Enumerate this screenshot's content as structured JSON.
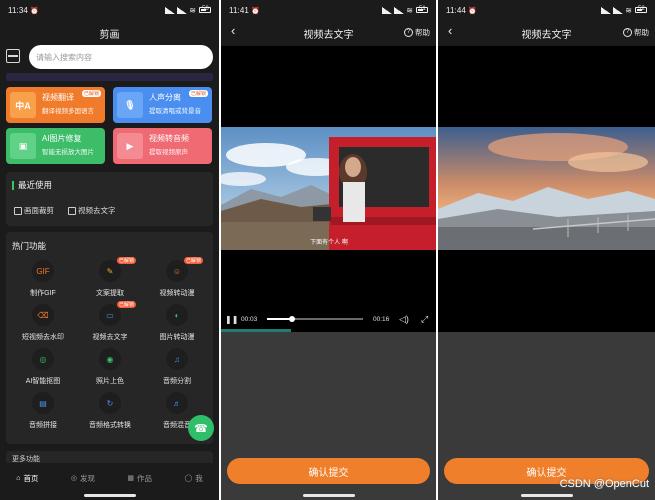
{
  "screen1": {
    "status": {
      "time": "11:34",
      "battery": "50"
    },
    "title": "剪画",
    "search_placeholder": "请输入搜索内容",
    "cards": [
      {
        "title": "视频翻译",
        "subtitle": "翻译视频多国语言",
        "tag": "已解锁",
        "icon_text": "中A",
        "color": "#f07b2a"
      },
      {
        "title": "人声分离",
        "subtitle": "提取清唱或背景音",
        "tag": "已解锁",
        "icon_text": "",
        "color": "#4a8ff0"
      },
      {
        "title": "AI图片修复",
        "subtitle": "智能无损放大图片",
        "tag": "",
        "icon_text": "",
        "color": "#3dbd68"
      },
      {
        "title": "视频转音频",
        "subtitle": "提取视频原声",
        "tag": "",
        "icon_text": "",
        "color": "#ef6a72"
      }
    ],
    "recent": {
      "title": "最近使用",
      "items": [
        "画面裁剪",
        "视频去文字"
      ]
    },
    "hot": {
      "title": "热门功能",
      "tools": [
        {
          "label": "制作GIF",
          "badge": "",
          "icon": "gif-icon",
          "glyph": "GIF"
        },
        {
          "label": "文案提取",
          "badge": "已解锁",
          "icon": "text-extract-icon",
          "glyph": "✎"
        },
        {
          "label": "视频转动漫",
          "badge": "已解锁",
          "icon": "anime-icon",
          "glyph": "☺"
        },
        {
          "label": "短视频去水印",
          "badge": "",
          "icon": "watermark-remove-icon",
          "glyph": "⌫"
        },
        {
          "label": "视频去文字",
          "badge": "已解锁",
          "icon": "video-text-remove-icon",
          "glyph": "▭"
        },
        {
          "label": "图片转动漫",
          "badge": "",
          "icon": "image-anime-icon",
          "glyph": "◐"
        },
        {
          "label": "AI智能抠图",
          "badge": "",
          "icon": "ai-cutout-icon",
          "glyph": "◎"
        },
        {
          "label": "照片上色",
          "badge": "",
          "icon": "photo-color-icon",
          "glyph": "◉"
        },
        {
          "label": "音频分割",
          "badge": "",
          "icon": "audio-split-icon",
          "glyph": "♫"
        },
        {
          "label": "音频拼接",
          "badge": "",
          "icon": "audio-join-icon",
          "glyph": "▤"
        },
        {
          "label": "音频格式转换",
          "badge": "",
          "icon": "audio-convert-icon",
          "glyph": "↻"
        },
        {
          "label": "音频混音",
          "badge": "",
          "icon": "audio-mix-icon",
          "glyph": "♬"
        }
      ]
    },
    "more_title": "更多功能",
    "tabs": [
      {
        "label": "首页",
        "icon": "home-icon",
        "active": true
      },
      {
        "label": "发现",
        "icon": "discover-icon",
        "active": false
      },
      {
        "label": "作品",
        "icon": "works-icon",
        "active": false
      },
      {
        "label": "我",
        "icon": "profile-icon",
        "active": false
      }
    ]
  },
  "screen2": {
    "status": {
      "time": "11:41",
      "battery": "51"
    },
    "title": "视频去文字",
    "help": "帮助",
    "subtitle_caption": "下面有个人 啊",
    "time_current": "00:03",
    "time_total": "00:16",
    "progress_fraction": 0.26,
    "submit": "确认提交"
  },
  "screen3": {
    "status": {
      "time": "11:44",
      "battery": "52"
    },
    "title": "视频去文字",
    "help": "帮助",
    "submit": "确认提交"
  },
  "watermark": "CSDN @OpenCut"
}
